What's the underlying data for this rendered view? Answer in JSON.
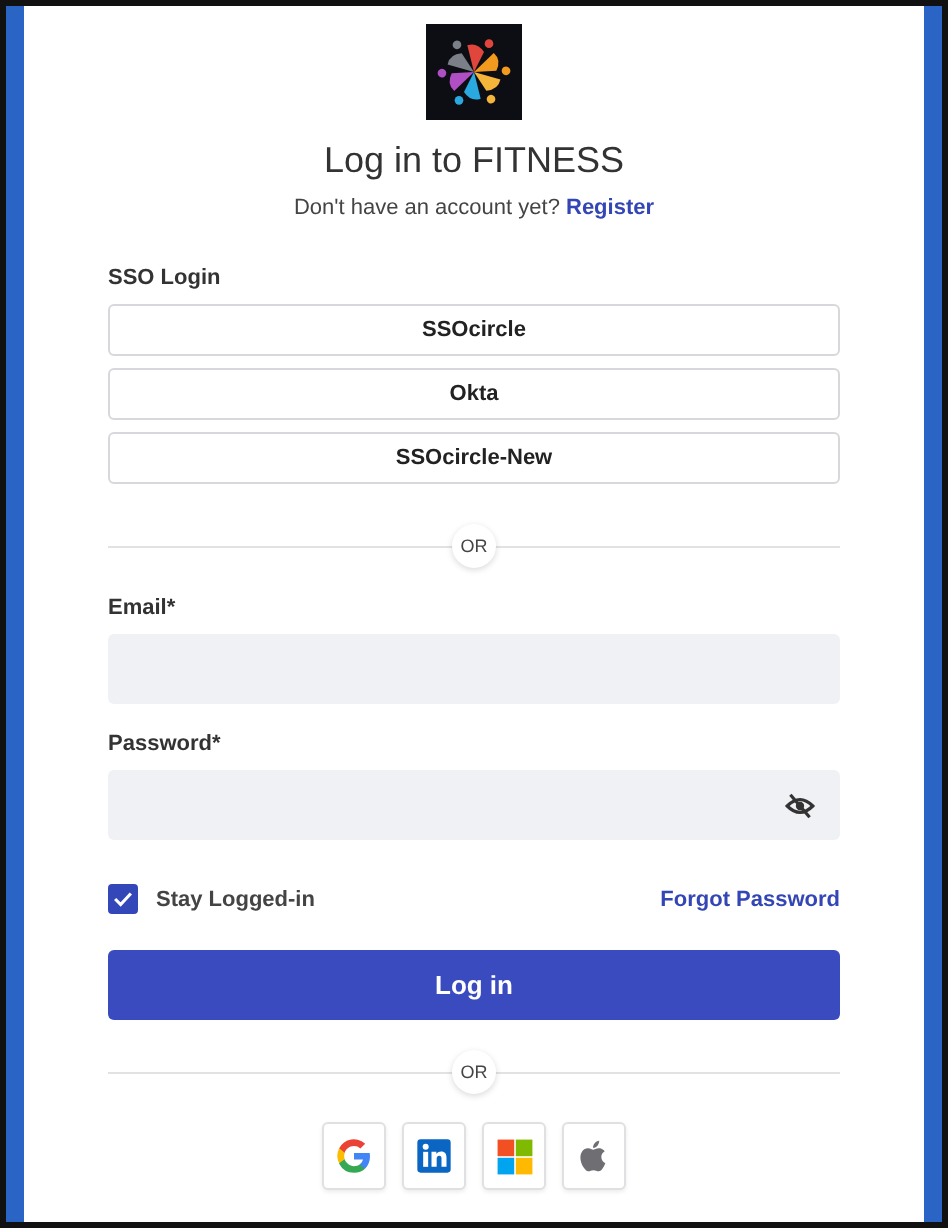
{
  "title": "Log in to FITNESS",
  "signup": {
    "prompt": "Don't have an account yet?",
    "link": "Register"
  },
  "sso": {
    "label": "SSO Login",
    "providers": [
      "SSOcircle",
      "Okta",
      "SSOcircle-New"
    ]
  },
  "divider_1": "OR",
  "fields": [
    {
      "label": "Email*",
      "kind": "email"
    },
    {
      "label": "Password*",
      "kind": "password"
    }
  ],
  "stay_logged_in": {
    "label": "Stay Logged-in",
    "checked": true
  },
  "forgot": "Forgot Password",
  "submit": "Log in",
  "divider_2": "OR",
  "social": [
    {
      "kind": "google"
    },
    {
      "kind": "linkedin"
    },
    {
      "kind": "microsoft"
    },
    {
      "kind": "apple"
    }
  ]
}
